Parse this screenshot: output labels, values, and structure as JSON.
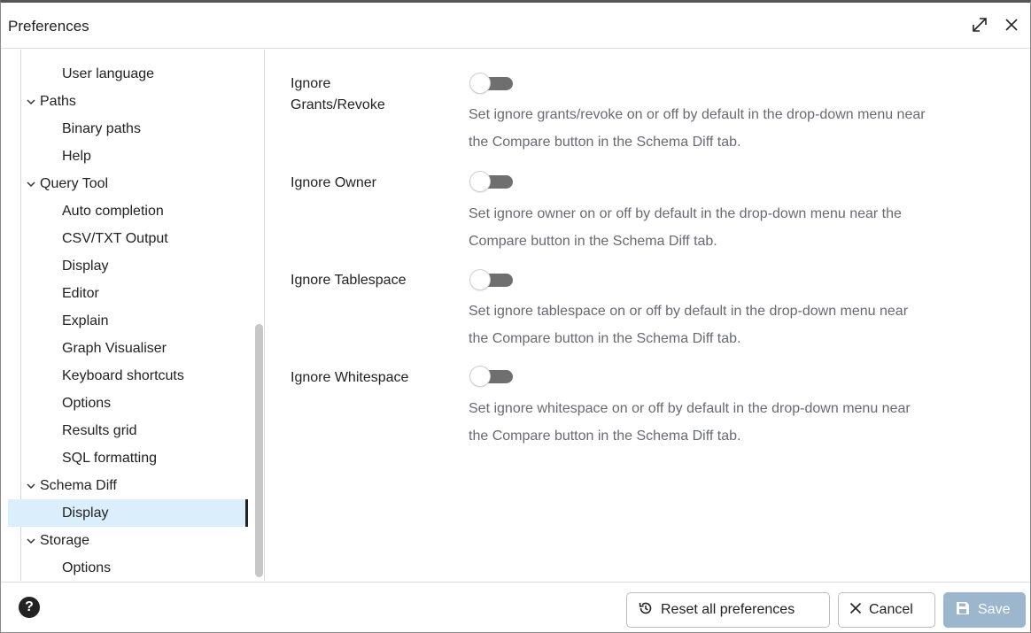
{
  "window": {
    "title": "Preferences",
    "maximize_icon": "expand-icon",
    "close_icon": "close-icon"
  },
  "sidebar": {
    "items": [
      {
        "label": "User language",
        "level": "child",
        "expanded": null
      },
      {
        "label": "Paths",
        "level": "parent",
        "expanded": true
      },
      {
        "label": "Binary paths",
        "level": "child",
        "expanded": null
      },
      {
        "label": "Help",
        "level": "child",
        "expanded": null
      },
      {
        "label": "Query Tool",
        "level": "parent",
        "expanded": true
      },
      {
        "label": "Auto completion",
        "level": "child",
        "expanded": null
      },
      {
        "label": "CSV/TXT Output",
        "level": "child",
        "expanded": null
      },
      {
        "label": "Display",
        "level": "child",
        "expanded": null
      },
      {
        "label": "Editor",
        "level": "child",
        "expanded": null
      },
      {
        "label": "Explain",
        "level": "child",
        "expanded": null
      },
      {
        "label": "Graph Visualiser",
        "level": "child",
        "expanded": null
      },
      {
        "label": "Keyboard shortcuts",
        "level": "child",
        "expanded": null
      },
      {
        "label": "Options",
        "level": "child",
        "expanded": null
      },
      {
        "label": "Results grid",
        "level": "child",
        "expanded": null
      },
      {
        "label": "SQL formatting",
        "level": "child",
        "expanded": null
      },
      {
        "label": "Schema Diff",
        "level": "parent",
        "expanded": true
      },
      {
        "label": "Display",
        "level": "child",
        "expanded": null,
        "selected": true
      },
      {
        "label": "Storage",
        "level": "parent",
        "expanded": true
      },
      {
        "label": "Options",
        "level": "child",
        "expanded": null
      }
    ]
  },
  "settings": [
    {
      "label_line1": "Ignore",
      "label_line2": "Grants/Revoke",
      "enabled": false,
      "desc_line1": "Set ignore grants/revoke on or off by default in the drop-down menu near",
      "desc_line2": "the Compare button in the Schema Diff tab."
    },
    {
      "label_line1": "Ignore Owner",
      "label_line2": "",
      "enabled": false,
      "desc_line1": "Set ignore owner on or off by default in the drop-down menu near the",
      "desc_line2": "Compare button in the Schema Diff tab."
    },
    {
      "label_line1": "Ignore Tablespace",
      "label_line2": "",
      "enabled": false,
      "desc_line1": "Set ignore tablespace on or off by default in the drop-down menu near",
      "desc_line2": "the Compare button in the Schema Diff tab."
    },
    {
      "label_line1": "Ignore Whitespace",
      "label_line2": "",
      "enabled": false,
      "desc_line1": "Set ignore whitespace on or off by default in the drop-down menu near",
      "desc_line2": "the Compare button in the Schema Diff tab."
    }
  ],
  "footer": {
    "help_label": "?",
    "reset_label": "Reset all preferences",
    "cancel_label": "Cancel",
    "save_label": "Save"
  },
  "colors": {
    "selected_bg": "#dbeefc",
    "save_bg": "#9cb6cd",
    "toggle_track": "#6f6f6f",
    "description_text": "#666b73"
  }
}
